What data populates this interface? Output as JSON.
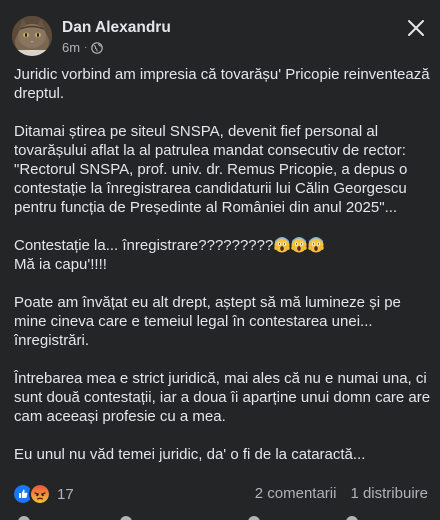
{
  "post": {
    "author": "Dan Alexandru",
    "time": "6m",
    "separator": "·",
    "privacy_icon": "globe-icon",
    "close_icon": "close-icon",
    "paragraphs": [
      "Juridic vorbind am impresia că tovarășu' Pricopie reinventează dreptul.",
      "Ditamai știrea pe siteul SNSPA, devenit fief personal al tovarășului aflat la al patrulea mandat consecutiv de rector: \"Rectorul SNSPA, prof. univ. dr. Remus Pricopie, a depus o contestație la înregistrarea candidaturii lui Călin Georgescu pentru funcția de Președinte al României din anul 2025\"...",
      "Poate am învățat eu alt drept, aștept să mă lumineze și pe mine cineva care e temeiul legal în contestarea unei... înregistrări.",
      "Întrebarea mea e strict juridică, mai ales că nu e numai una, ci sunt două contestații, iar a doua îi aparține unui domn care are cam aceeași profesie cu a mea.",
      "Eu unul nu văd temei juridic, da' o fi de la cataractă..."
    ],
    "exclaim_line1": "Contestație la... înregistrare?????????",
    "exclaim_line2": "Mă ia capu'!!!!",
    "exclaim_emoji": "screaming-face-emoji"
  },
  "footer": {
    "reaction_icons": [
      "like-icon",
      "angry-icon"
    ],
    "reaction_count": "17",
    "comments": "2 comentarii",
    "shares": "1 distribuire"
  },
  "colors": {
    "background": "#242526",
    "text": "#e4e6eb",
    "secondary_text": "#b0b3b8",
    "like_blue": "#1877f2",
    "angry_orange": "#f0892b"
  }
}
